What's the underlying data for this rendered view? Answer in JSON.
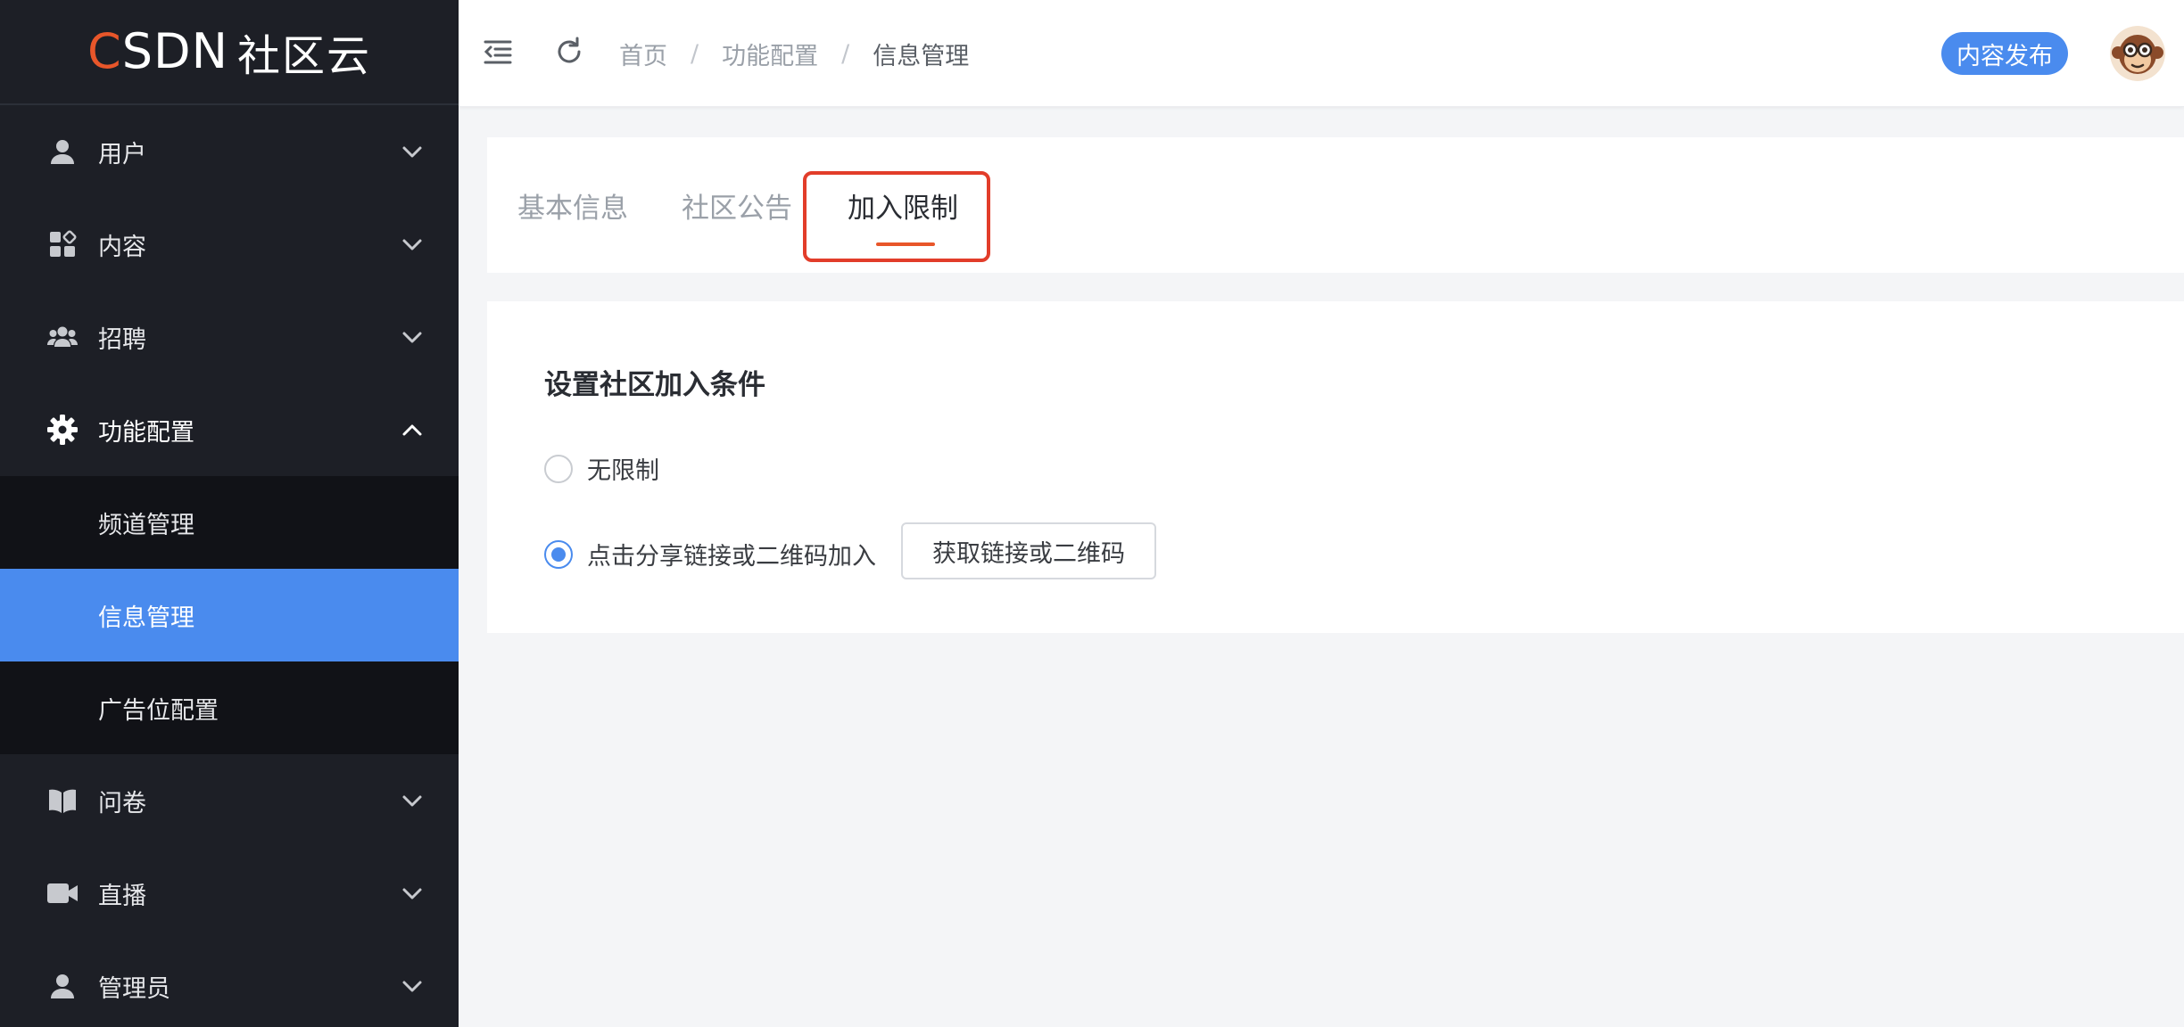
{
  "logo": {
    "brand_prefix": "C",
    "brand_rest": "SDN",
    "brand_cn": "社区云"
  },
  "sidebar": {
    "items": [
      {
        "label": "用户",
        "icon": "user-icon",
        "expanded": false
      },
      {
        "label": "内容",
        "icon": "content-grid-icon",
        "expanded": false
      },
      {
        "label": "招聘",
        "icon": "team-icon",
        "expanded": false
      },
      {
        "label": "功能配置",
        "icon": "gear-icon",
        "expanded": true,
        "children": [
          {
            "label": "频道管理",
            "active": false
          },
          {
            "label": "信息管理",
            "active": true
          },
          {
            "label": "广告位配置",
            "active": false
          }
        ]
      },
      {
        "label": "问卷",
        "icon": "book-icon",
        "expanded": false
      },
      {
        "label": "直播",
        "icon": "video-camera-icon",
        "expanded": false
      },
      {
        "label": "管理员",
        "icon": "user-icon",
        "expanded": false
      }
    ]
  },
  "header": {
    "breadcrumb": [
      "首页",
      "功能配置",
      "信息管理"
    ],
    "breadcrumb_separator": "/",
    "publish_label": "内容发布"
  },
  "tabs": {
    "items": [
      "基本信息",
      "社区公告",
      "加入限制"
    ],
    "active_index": 2
  },
  "settings": {
    "title": "设置社区加入条件",
    "options": [
      {
        "label": "无限制",
        "checked": false
      },
      {
        "label": "点击分享链接或二维码加入",
        "checked": true
      }
    ],
    "link_button_label": "获取链接或二维码"
  },
  "colors": {
    "sidebar_bg": "#1d1f26",
    "submenu_bg": "#111217",
    "accent_blue": "#4a8bee",
    "accent_orange": "#e8562a",
    "highlight_red": "#e23d2a"
  }
}
